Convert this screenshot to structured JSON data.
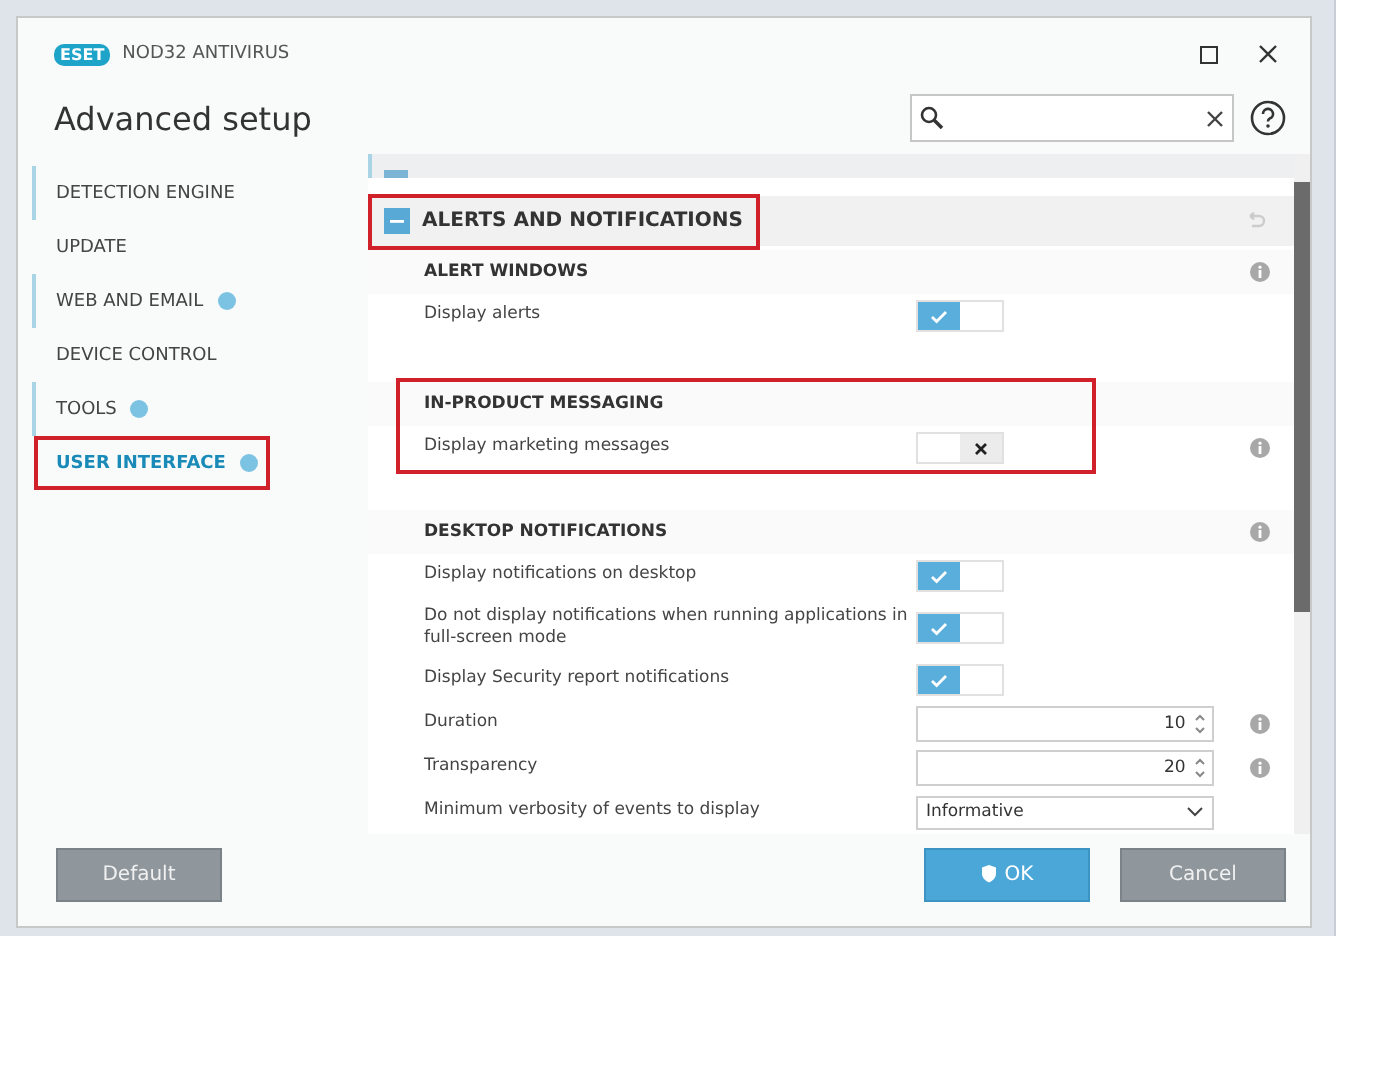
{
  "window": {
    "logo": "ESET",
    "product": "NOD32 ANTIVIRUS",
    "title": "Advanced setup"
  },
  "sidebar": {
    "items": [
      {
        "label": "DETECTION ENGINE",
        "selected": false,
        "marked": true,
        "badge": false,
        "highlighted": false
      },
      {
        "label": "UPDATE",
        "selected": false,
        "marked": false,
        "badge": false,
        "highlighted": false
      },
      {
        "label": "WEB AND EMAIL",
        "selected": false,
        "marked": true,
        "badge": true,
        "highlighted": false
      },
      {
        "label": "DEVICE CONTROL",
        "selected": false,
        "marked": false,
        "badge": false,
        "highlighted": false
      },
      {
        "label": "TOOLS",
        "selected": false,
        "marked": true,
        "badge": true,
        "highlighted": false
      },
      {
        "label": "USER INTERFACE",
        "selected": true,
        "marked": false,
        "badge": true,
        "highlighted": true
      }
    ]
  },
  "panel": {
    "header": {
      "title": "ALERTS AND NOTIFICATIONS",
      "expanded": true,
      "highlighted": true
    },
    "sections": [
      {
        "title": "ALERT WINDOWS",
        "info": true,
        "highlighted": false,
        "rows": [
          {
            "kind": "toggle",
            "label": "Display alerts",
            "on": true,
            "info": false
          }
        ]
      },
      {
        "title": "IN-PRODUCT MESSAGING",
        "info": false,
        "highlighted": true,
        "rows": [
          {
            "kind": "toggle",
            "label": "Display marketing messages",
            "on": false,
            "info": true
          }
        ]
      },
      {
        "title": "DESKTOP NOTIFICATIONS",
        "info": true,
        "highlighted": false,
        "rows": [
          {
            "kind": "toggle",
            "label": "Display notifications on desktop",
            "on": true,
            "info": false
          },
          {
            "kind": "toggle",
            "label": "Do not display notifications when running applications in full-screen mode",
            "on": true,
            "info": false
          },
          {
            "kind": "toggle",
            "label": "Display Security report notifications",
            "on": true,
            "info": false
          },
          {
            "kind": "number",
            "label": "Duration",
            "value": "10",
            "info": true
          },
          {
            "kind": "number",
            "label": "Transparency",
            "value": "20",
            "info": true
          },
          {
            "kind": "select",
            "label": "Minimum verbosity of events to display",
            "value": "Informative",
            "info": false
          }
        ]
      }
    ]
  },
  "buttons": {
    "default": "Default",
    "ok": "OK",
    "cancel": "Cancel"
  }
}
